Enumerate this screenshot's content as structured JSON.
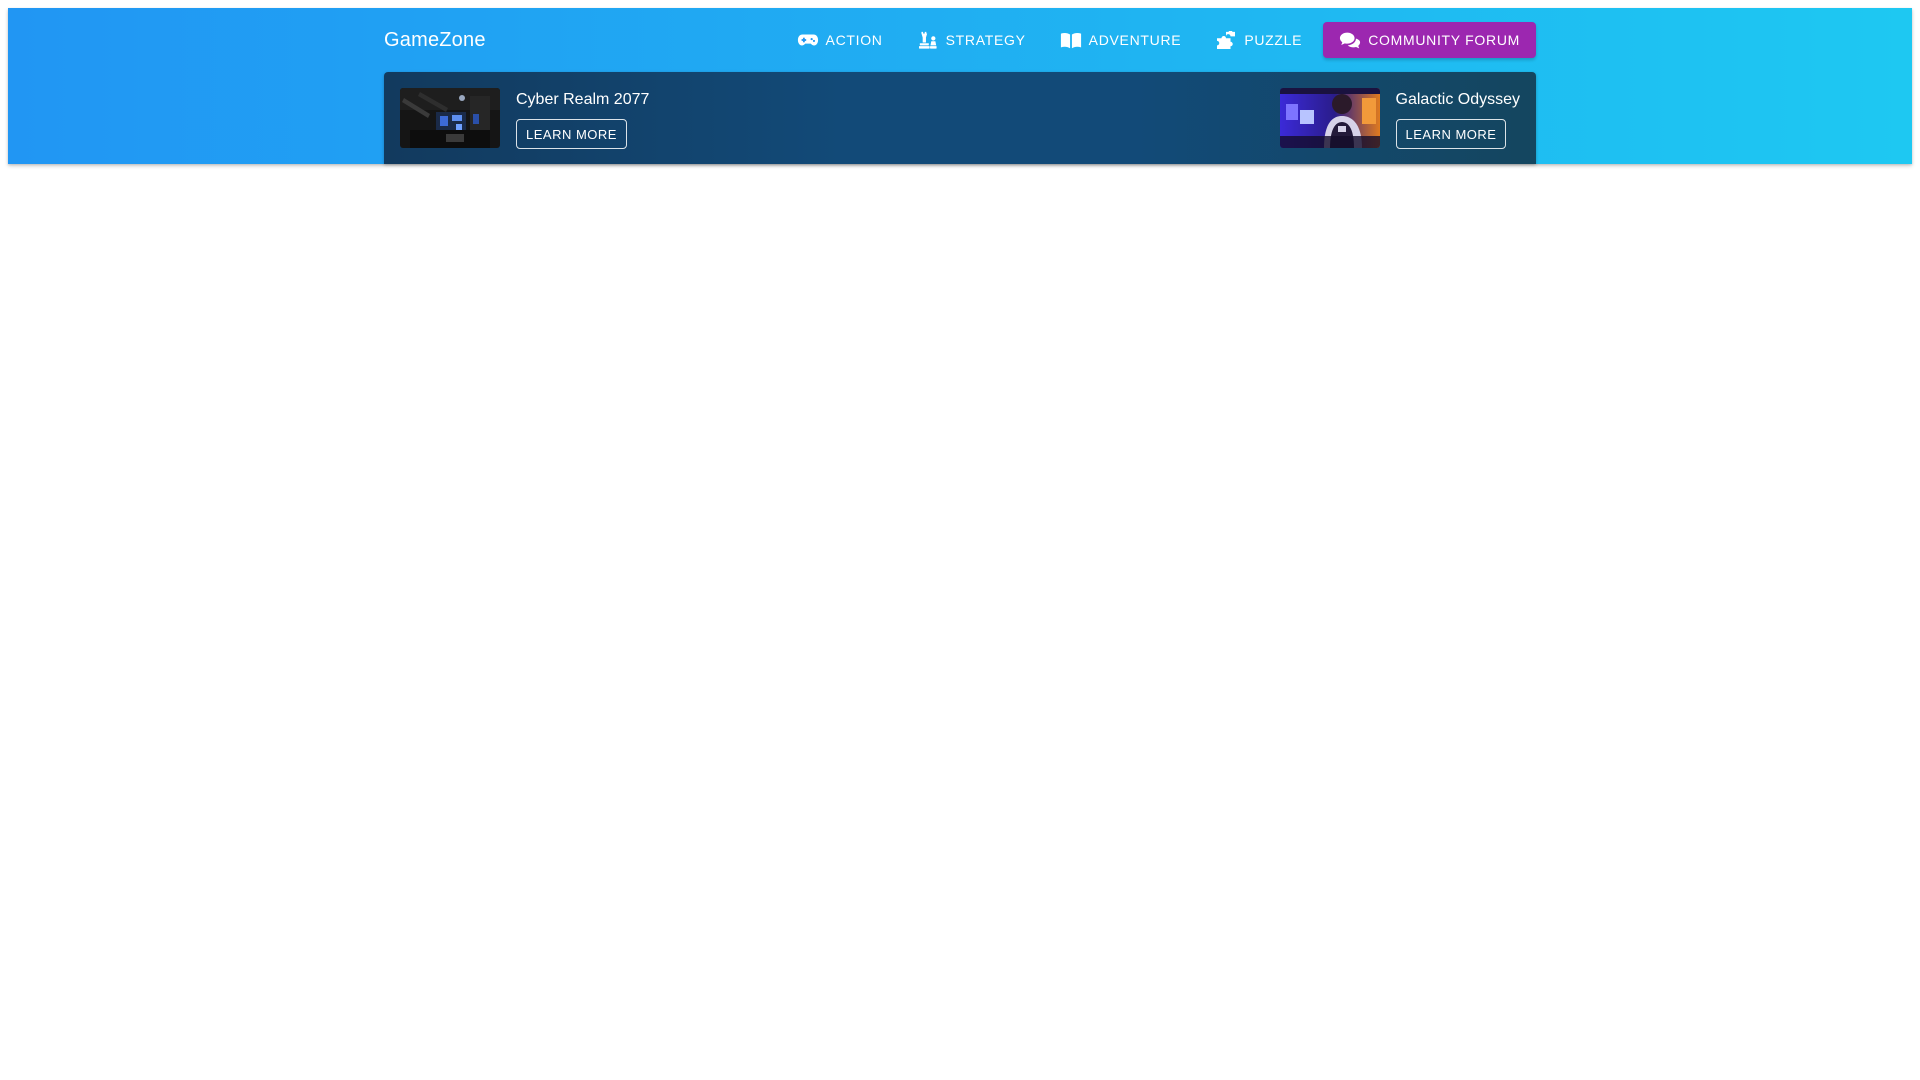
{
  "header": {
    "brand": "GameZone",
    "colors": {
      "gradient_start": "#2196f3",
      "gradient_end": "#1ec8f2",
      "forum_button": "#9c27b0"
    }
  },
  "nav": {
    "items": [
      {
        "label": "ACTION",
        "icon": "gamepad-icon"
      },
      {
        "label": "STRATEGY",
        "icon": "chess-icon"
      },
      {
        "label": "ADVENTURE",
        "icon": "book-open-icon"
      },
      {
        "label": "PUZZLE",
        "icon": "puzzle-piece-icon"
      },
      {
        "label": "COMMUNITY FORUM",
        "icon": "comments-icon"
      }
    ]
  },
  "featured": {
    "games": [
      {
        "title": "Cyber Realm 2077",
        "button": "LEARN MORE"
      },
      {
        "title": "Galactic Odyssey",
        "button": "LEARN MORE"
      }
    ]
  }
}
